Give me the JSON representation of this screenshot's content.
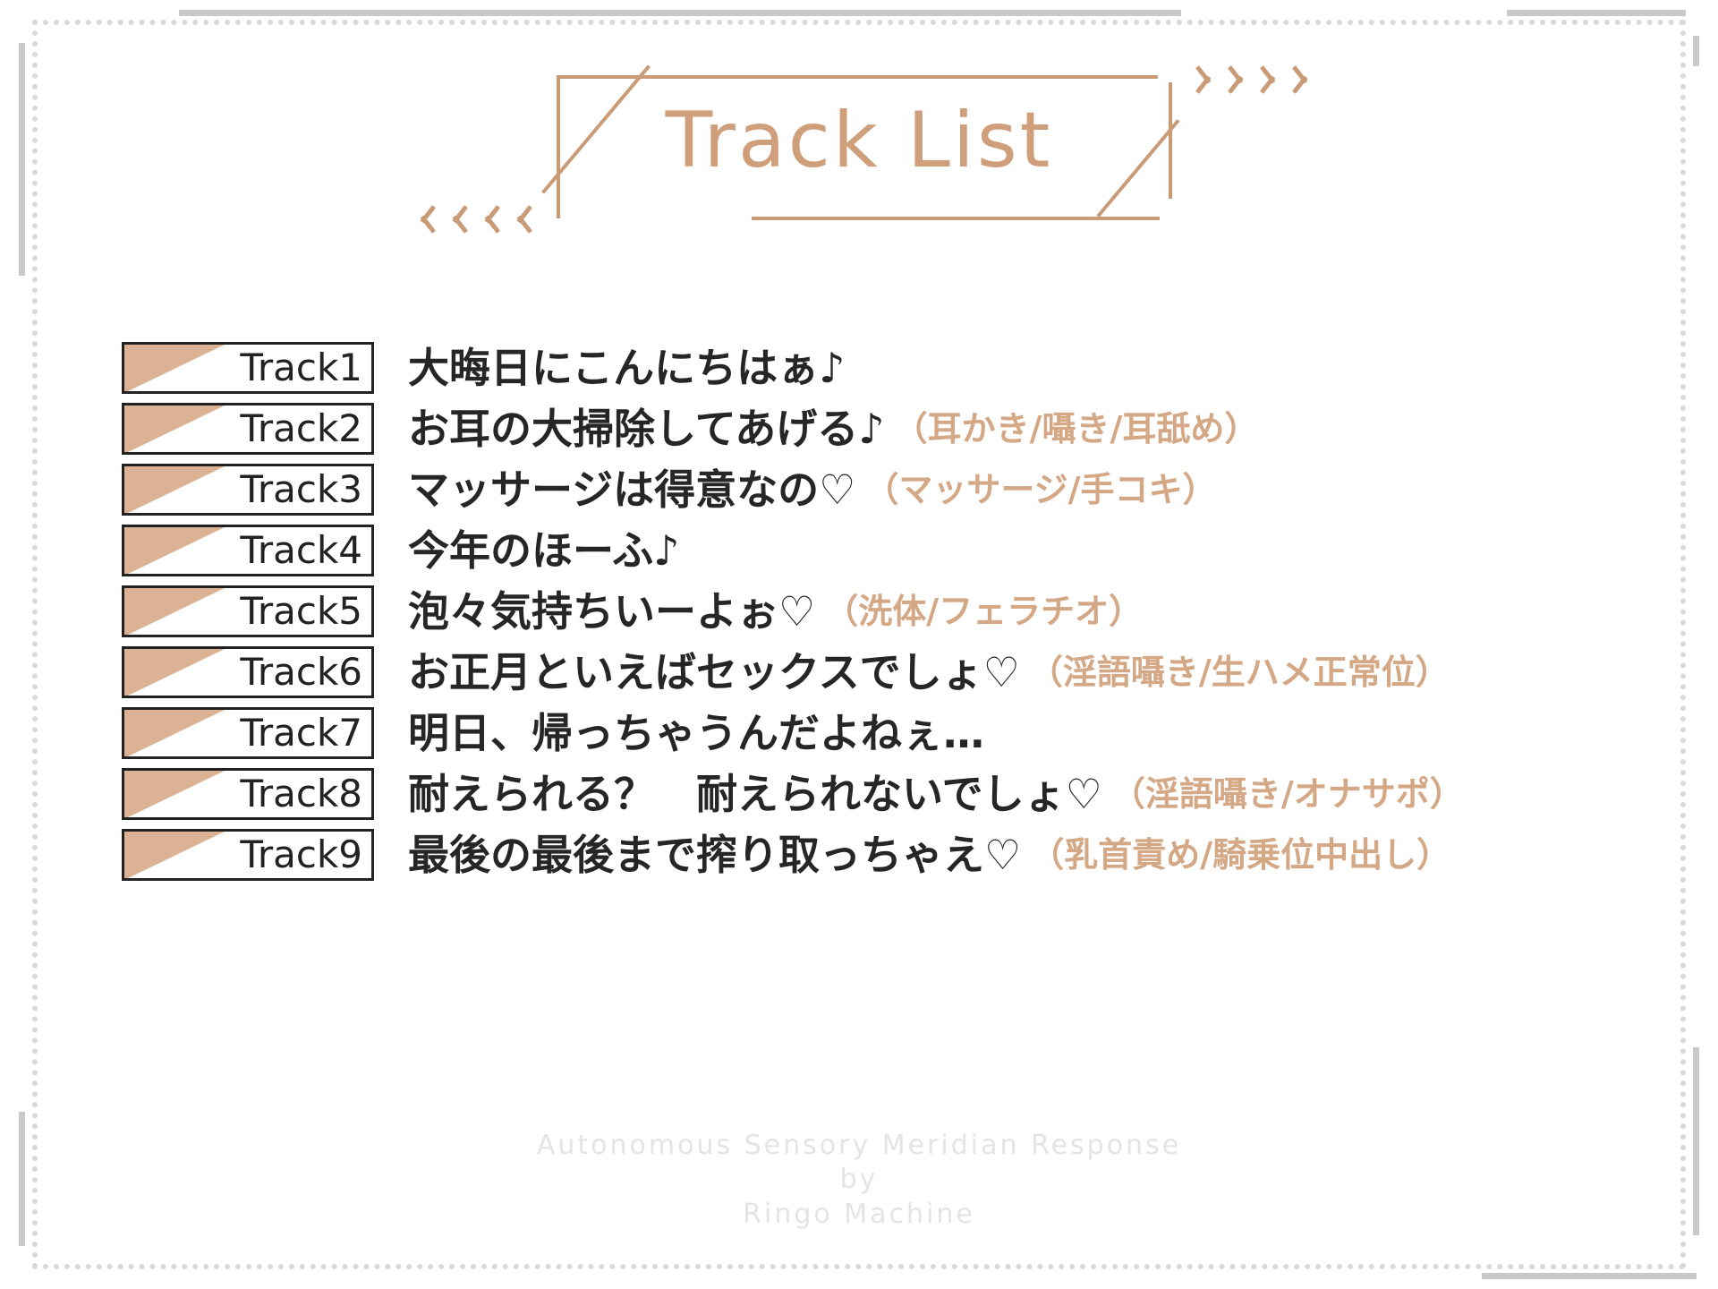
{
  "page": {
    "title": "Track List",
    "accent_color": "#cf9f7b",
    "badge_fill_color": "#dcb294",
    "tag_color": "#d4a785",
    "text_color": "#262626",
    "frame_color": "#d9d9d9"
  },
  "title_decor": {
    "chevrons_right": [
      ">",
      ">",
      ">",
      ">"
    ],
    "chevrons_left": [
      "<",
      "<",
      "<",
      "<"
    ]
  },
  "tracks": [
    {
      "badge": "Track1",
      "title": "大晦日にこんにちはぁ♪",
      "tag": ""
    },
    {
      "badge": "Track2",
      "title": "お耳の大掃除してあげる♪",
      "tag": "（耳かき/囁き/耳舐め）"
    },
    {
      "badge": "Track3",
      "title": "マッサージは得意なの♡",
      "tag": "（マッサージ/手コキ）"
    },
    {
      "badge": "Track4",
      "title": "今年のほーふ♪",
      "tag": ""
    },
    {
      "badge": "Track5",
      "title": "泡々気持ちいーよぉ♡",
      "tag": "（洗体/フェラチオ）"
    },
    {
      "badge": "Track6",
      "title": "お正月といえばセックスでしょ♡",
      "tag": "（淫語囁き/生ハメ正常位）"
    },
    {
      "badge": "Track7",
      "title": "明日、帰っちゃうんだよねぇ…",
      "tag": ""
    },
    {
      "badge": "Track8",
      "title": "耐えられる？　耐えられないでしょ♡",
      "tag": "（淫語囁き/オナサポ）"
    },
    {
      "badge": "Track9",
      "title": "最後の最後まで搾り取っちゃえ♡",
      "tag": "（乳首責め/騎乗位中出し）"
    }
  ],
  "footer": {
    "line1": "Autonomous Sensory Meridian Response",
    "line2": "by",
    "line3": "Ringo Machine"
  }
}
